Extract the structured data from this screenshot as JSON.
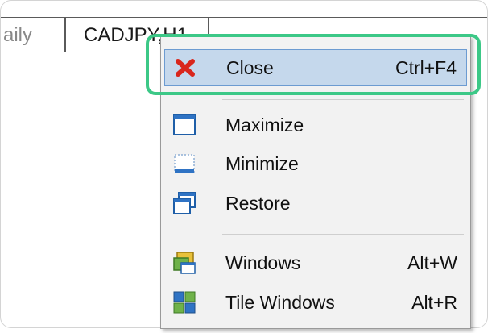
{
  "tabs": [
    {
      "label": "aily"
    },
    {
      "label": "CADJPY,H1"
    }
  ],
  "menu": {
    "items": [
      {
        "label": "Close",
        "shortcut": "Ctrl+F4",
        "icon": "close-icon"
      },
      {
        "label": "Maximize",
        "shortcut": "",
        "icon": "maximize-icon"
      },
      {
        "label": "Minimize",
        "shortcut": "",
        "icon": "minimize-icon"
      },
      {
        "label": "Restore",
        "shortcut": "",
        "icon": "restore-icon"
      },
      {
        "label": "Windows",
        "shortcut": "Alt+W",
        "icon": "windows-icon"
      },
      {
        "label": "Tile Windows",
        "shortcut": "Alt+R",
        "icon": "tile-windows-icon"
      }
    ]
  },
  "colors": {
    "highlight": "#c5d8ec",
    "focus_ring": "#3cc887",
    "close_red": "#d9261c"
  }
}
